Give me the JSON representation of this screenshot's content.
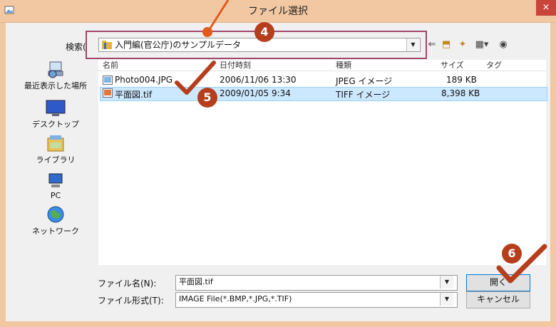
{
  "window": {
    "title": "ファイル選択",
    "close_label": "×"
  },
  "search": {
    "label": "検索(",
    "current_folder": "入門編(官公庁)のサンプルデータ"
  },
  "sidebar": {
    "items": [
      {
        "label": "最近表示した場所"
      },
      {
        "label": "デスクトップ"
      },
      {
        "label": "ライブラリ"
      },
      {
        "label": "PC"
      },
      {
        "label": "ネットワーク"
      }
    ]
  },
  "file_list": {
    "columns": [
      "名前",
      "日付時刻",
      "種類",
      "サイズ",
      "タグ"
    ],
    "rows": [
      {
        "name": "Photo004.JPG",
        "date": "2006/11/06 13:30",
        "type": "JPEG イメージ",
        "size": "189 KB"
      },
      {
        "name": "平面図.tif",
        "date": "2009/01/05 9:34",
        "type": "TIFF イメージ",
        "size": "8,398 KB"
      }
    ]
  },
  "file_name": {
    "label": "ファイル名(N):",
    "value": "平面図.tif"
  },
  "file_type": {
    "label": "ファイル形式(T):",
    "value": "IMAGE File(*.BMP,*.JPG,*.TIF)"
  },
  "buttons": {
    "open": "開く",
    "cancel": "キャンセル"
  },
  "annotations": {
    "step4": "4",
    "step5": "5",
    "step6": "6"
  },
  "colors": {
    "title_bar": "#f1c8a2",
    "close": "#c7453b",
    "selection": "#cce8ff",
    "annotation_box": "#a0466c",
    "badge": "#b53e1c",
    "check": "#b53e1c"
  }
}
